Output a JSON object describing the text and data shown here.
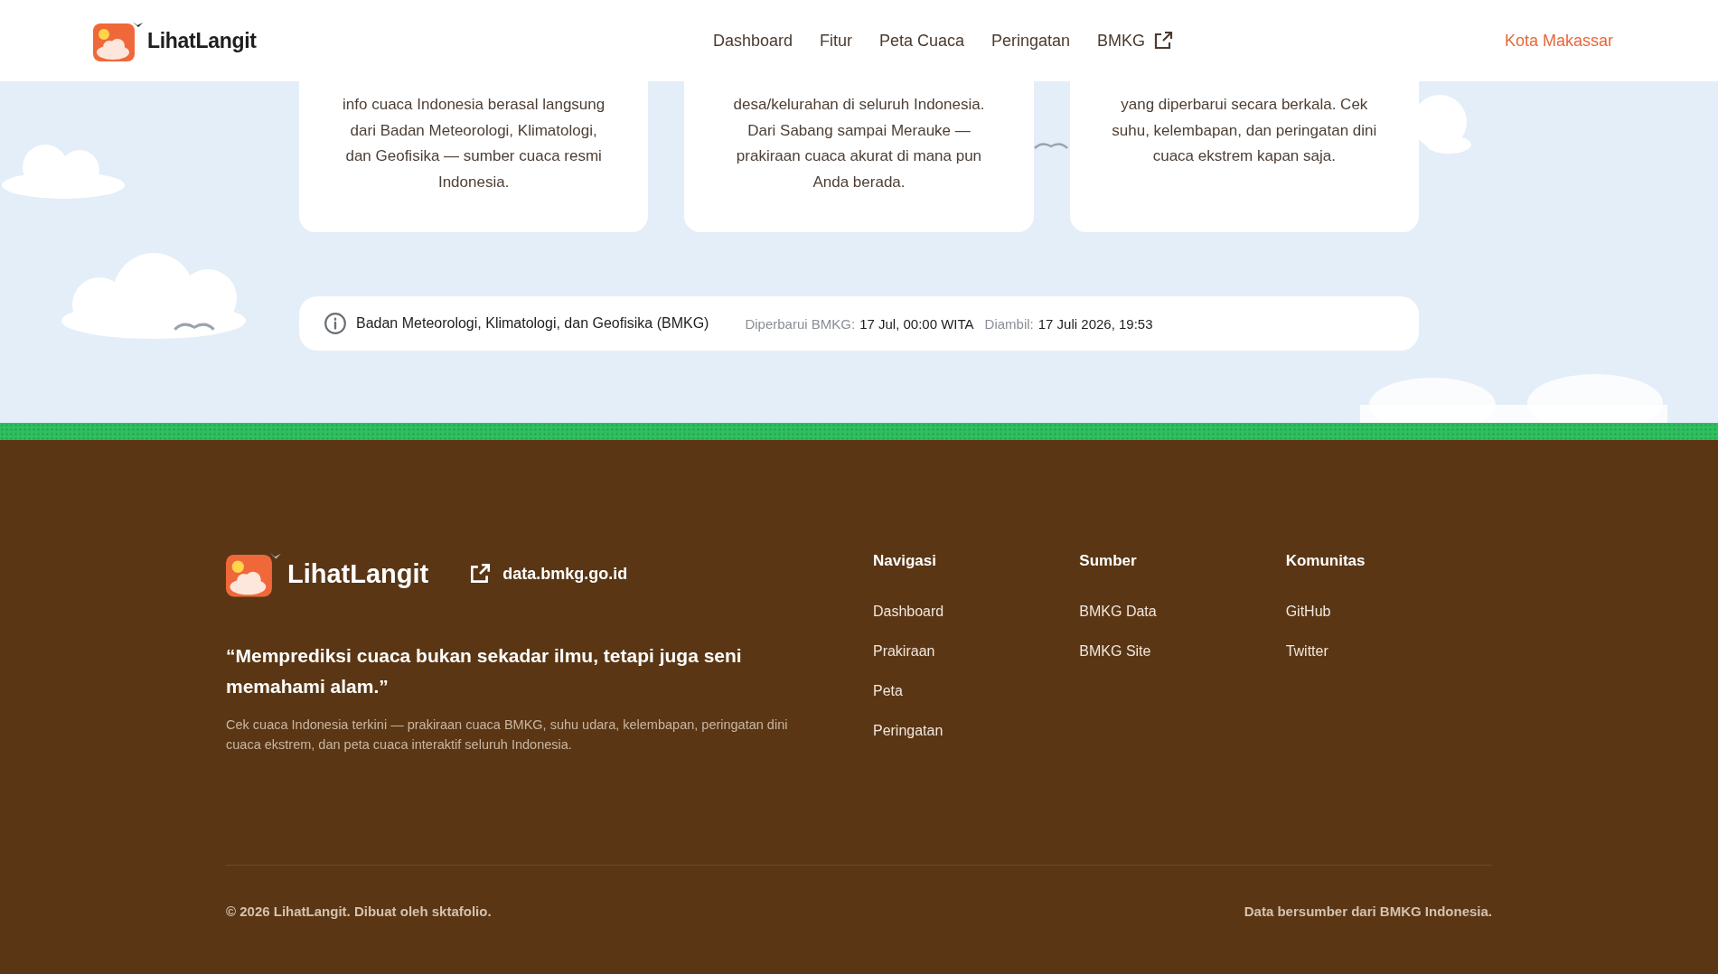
{
  "header": {
    "brand": "LihatLangit",
    "nav": [
      {
        "label": "Dashboard",
        "external": false
      },
      {
        "label": "Fitur",
        "external": false
      },
      {
        "label": "Peta Cuaca",
        "external": false
      },
      {
        "label": "Peringatan",
        "external": false
      },
      {
        "label": "BMKG",
        "external": true
      }
    ],
    "city": "Kota Makassar"
  },
  "cards": [
    {
      "text": "info cuaca Indonesia berasal langsung dari Badan Meteorologi, Klimatologi, dan Geofisika — sumber cuaca resmi Indonesia."
    },
    {
      "text": "desa/kelurahan di seluruh Indonesia. Dari Sabang sampai Merauke — prakiraan cuaca akurat di mana pun Anda berada."
    },
    {
      "text": "yang diperbarui secara berkala. Cek suhu, kelembapan, dan peringatan dini cuaca ekstrem kapan saja."
    }
  ],
  "source_bar": {
    "source": "Badan Meteorologi, Klimatologi, dan Geofisika (BMKG)",
    "updated_label": "Diperbarui BMKG:",
    "updated_value": "17 Jul, 00:00 WITA",
    "fetched_label": "Diambil:",
    "fetched_value": "17 Juli 2026, 19:53"
  },
  "footer": {
    "brand": "LihatLangit",
    "link": "data.bmkg.go.id",
    "quote": "“Memprediksi cuaca bukan sekadar ilmu, tetapi juga seni memahami alam.”",
    "description": "Cek cuaca Indonesia terkini — prakiraan cuaca BMKG, suhu udara, kelembapan, peringatan dini cuaca ekstrem, dan peta cuaca interaktif seluruh Indonesia.",
    "columns": [
      {
        "title": "Navigasi",
        "links": [
          "Dashboard",
          "Prakiraan",
          "Peta",
          "Peringatan"
        ]
      },
      {
        "title": "Sumber",
        "links": [
          "BMKG Data",
          "BMKG Site"
        ]
      },
      {
        "title": "Komunitas",
        "links": [
          "GitHub",
          "Twitter"
        ]
      }
    ],
    "copyright": "© 2026 LihatLangit. Dibuat oleh sktafolio.",
    "credit": "Data bersumber dari BMKG Indonesia."
  }
}
